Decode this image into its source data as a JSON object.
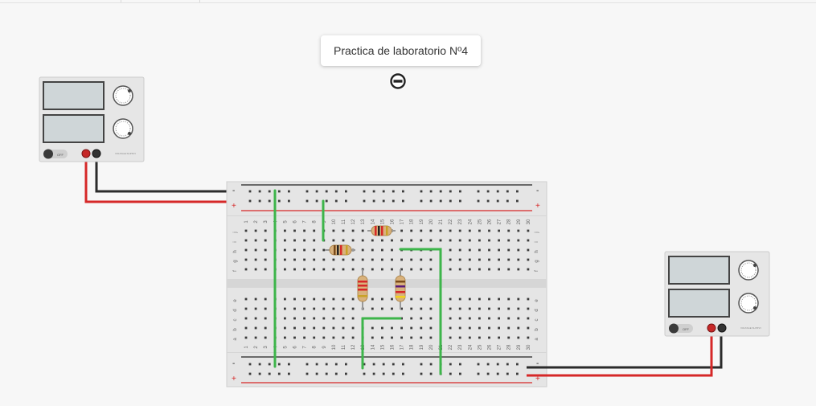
{
  "note": {
    "text": "Practica de laboratorio Nº4"
  },
  "supply": {
    "switch_label": "OFF",
    "brand": "VOLTAGE SUPPLY"
  },
  "breadboard": {
    "rail_minus": "-",
    "rail_plus": "+",
    "row_letters_top": [
      "j",
      "i",
      "h",
      "g",
      "f"
    ],
    "row_letters_bottom": [
      "e",
      "d",
      "c",
      "b",
      "a"
    ],
    "column_count": 30
  },
  "colors": {
    "wire_green": "#3db54a",
    "wire_red": "#d62828",
    "wire_black": "#2b2b2b",
    "rail_red": "#d62828",
    "rail_black": "#222222",
    "board": "#e5e5e5",
    "device": "#e6e6e6",
    "display": "#cfd6d8"
  }
}
